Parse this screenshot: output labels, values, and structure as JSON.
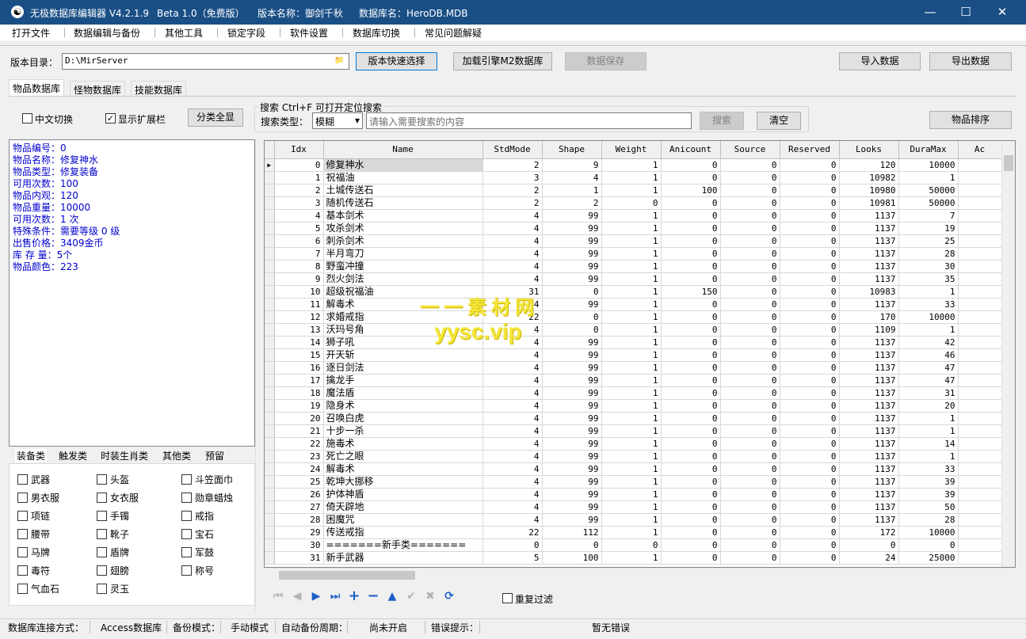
{
  "window": {
    "icon": "☯",
    "app_title": "无极数据库编辑器 V4.2.1.9",
    "edition": "Beta 1.0（免费版）",
    "version_name": "版本名称：御剑千秋",
    "db_name": "数据库名：HeroDB.MDB",
    "minimize_icon": "—",
    "maximize_icon": "☐",
    "close_icon": "✕"
  },
  "menu": [
    "打开文件",
    "数据编辑与备份",
    "其他工具",
    "锁定字段",
    "软件设置",
    "数据库切换",
    "常见问题解疑"
  ],
  "toolbar": {
    "dir_label": "版本目录：",
    "dir_value": "D:\\MirServer",
    "folder_icon": "📁",
    "quick_select": "版本快速选择",
    "load_engine": "加载引擎M2数据库",
    "save_data": "数据保存",
    "import": "导入数据",
    "export": "导出数据"
  },
  "tabs": [
    "物品数据库",
    "怪物数据库",
    "技能数据库"
  ],
  "options": {
    "chinese_switch": "中文切换",
    "show_extend": "显示扩展栏",
    "show_extend_checked": true,
    "chinese_checked": false,
    "show_all": "分类全显",
    "checkmark": "✓"
  },
  "search": {
    "group_title": "搜索   Ctrl+F 可打开定位搜索",
    "type_label": "搜索类型：",
    "type_value": "模糊",
    "placeholder": "请输入需要搜索的内容",
    "search_btn": "搜索",
    "clear_btn": "清空",
    "sort_btn": "物品排序",
    "dropdown_icon": "▾"
  },
  "info": [
    "物品编号：0",
    "物品名称：修复神水",
    "物品类型：修复装备",
    "可用次数：100",
    "物品内观：120",
    "物品重量：10000",
    "可用次数：1 次",
    "特殊条件：需要等级 0 级",
    "出售价格：3409金币",
    "库 存 量：5个",
    "物品颜色：223"
  ],
  "category_tabs": [
    "装备类",
    "触发类",
    "时装生肖类",
    "其他类",
    "预留"
  ],
  "categories": [
    [
      "武器",
      "头盔",
      "斗笠面巾"
    ],
    [
      "男衣服",
      "女衣服",
      "勋章蜡烛"
    ],
    [
      "项链",
      "手镯",
      "戒指"
    ],
    [
      "腰带",
      "靴子",
      "宝石"
    ],
    [
      "马牌",
      "盾牌",
      "军鼓"
    ],
    [
      "毒符",
      "翅膀",
      "称号"
    ],
    [
      "气血石",
      "灵玉",
      ""
    ]
  ],
  "grid": {
    "columns": [
      "Idx",
      "Name",
      "StdMode",
      "Shape",
      "Weight",
      "Anicount",
      "Source",
      "Reserved",
      "Looks",
      "DuraMax",
      "Ac"
    ],
    "row_indicator": "▶",
    "rows": [
      [
        "0",
        "修复神水",
        "2",
        "9",
        "1",
        "0",
        "0",
        "0",
        "120",
        "10000"
      ],
      [
        "1",
        "祝福油",
        "3",
        "4",
        "1",
        "0",
        "0",
        "0",
        "10982",
        "1"
      ],
      [
        "2",
        "土城传送石",
        "2",
        "1",
        "1",
        "100",
        "0",
        "0",
        "10980",
        "50000"
      ],
      [
        "3",
        "随机传送石",
        "2",
        "2",
        "0",
        "0",
        "0",
        "0",
        "10981",
        "50000"
      ],
      [
        "4",
        "基本剑术",
        "4",
        "99",
        "1",
        "0",
        "0",
        "0",
        "1137",
        "7"
      ],
      [
        "5",
        "攻杀剑术",
        "4",
        "99",
        "1",
        "0",
        "0",
        "0",
        "1137",
        "19"
      ],
      [
        "6",
        "刺杀剑术",
        "4",
        "99",
        "1",
        "0",
        "0",
        "0",
        "1137",
        "25"
      ],
      [
        "7",
        "半月弯刀",
        "4",
        "99",
        "1",
        "0",
        "0",
        "0",
        "1137",
        "28"
      ],
      [
        "8",
        "野蛮冲撞",
        "4",
        "99",
        "1",
        "0",
        "0",
        "0",
        "1137",
        "30"
      ],
      [
        "9",
        "烈火剑法",
        "4",
        "99",
        "1",
        "0",
        "0",
        "0",
        "1137",
        "35"
      ],
      [
        "10",
        "超级祝福油",
        "31",
        "0",
        "1",
        "150",
        "0",
        "0",
        "10983",
        "1"
      ],
      [
        "11",
        "解毒术",
        "4",
        "99",
        "1",
        "0",
        "0",
        "0",
        "1137",
        "33"
      ],
      [
        "12",
        "求婚戒指",
        "22",
        "0",
        "1",
        "0",
        "0",
        "0",
        "170",
        "10000"
      ],
      [
        "13",
        "沃玛号角",
        "4",
        "0",
        "1",
        "0",
        "0",
        "0",
        "1109",
        "1"
      ],
      [
        "14",
        "狮子吼",
        "4",
        "99",
        "1",
        "0",
        "0",
        "0",
        "1137",
        "42"
      ],
      [
        "15",
        "开天斩",
        "4",
        "99",
        "1",
        "0",
        "0",
        "0",
        "1137",
        "46"
      ],
      [
        "16",
        "逐日剑法",
        "4",
        "99",
        "1",
        "0",
        "0",
        "0",
        "1137",
        "47"
      ],
      [
        "17",
        "擒龙手",
        "4",
        "99",
        "1",
        "0",
        "0",
        "0",
        "1137",
        "47"
      ],
      [
        "18",
        "魔法盾",
        "4",
        "99",
        "1",
        "0",
        "0",
        "0",
        "1137",
        "31"
      ],
      [
        "19",
        "隐身术",
        "4",
        "99",
        "1",
        "0",
        "0",
        "0",
        "1137",
        "20"
      ],
      [
        "20",
        "召唤白虎",
        "4",
        "99",
        "1",
        "0",
        "0",
        "0",
        "1137",
        "1"
      ],
      [
        "21",
        "十步一杀",
        "4",
        "99",
        "1",
        "0",
        "0",
        "0",
        "1137",
        "1"
      ],
      [
        "22",
        "施毒术",
        "4",
        "99",
        "1",
        "0",
        "0",
        "0",
        "1137",
        "14"
      ],
      [
        "23",
        "死亡之眼",
        "4",
        "99",
        "1",
        "0",
        "0",
        "0",
        "1137",
        "1"
      ],
      [
        "24",
        "解毒术",
        "4",
        "99",
        "1",
        "0",
        "0",
        "0",
        "1137",
        "33"
      ],
      [
        "25",
        "乾坤大挪移",
        "4",
        "99",
        "1",
        "0",
        "0",
        "0",
        "1137",
        "39"
      ],
      [
        "26",
        "护体神盾",
        "4",
        "99",
        "1",
        "0",
        "0",
        "0",
        "1137",
        "39"
      ],
      [
        "27",
        "倚天辟地",
        "4",
        "99",
        "1",
        "0",
        "0",
        "0",
        "1137",
        "50"
      ],
      [
        "28",
        "困魔咒",
        "4",
        "99",
        "1",
        "0",
        "0",
        "0",
        "1137",
        "28"
      ],
      [
        "29",
        "传送戒指",
        "22",
        "112",
        "1",
        "0",
        "0",
        "0",
        "172",
        "10000"
      ],
      [
        "30",
        "=======新手类=======",
        "0",
        "0",
        "0",
        "0",
        "0",
        "0",
        "0",
        "0"
      ],
      [
        "31",
        "新手武器",
        "5",
        "100",
        "1",
        "0",
        "0",
        "0",
        "24",
        "25000"
      ]
    ]
  },
  "nav": {
    "first": "⏮",
    "prev": "◀",
    "next": "▶",
    "last": "⏭",
    "add": "+",
    "delete": "−",
    "up": "▲",
    "confirm": "✔",
    "cancel": "✖",
    "refresh": "⟳",
    "dup_filter": "重复过滤"
  },
  "status": {
    "conn_label": "数据库连接方式：",
    "conn_value": "Access数据库",
    "backup_label": "备份模式：",
    "backup_value": "手动模式",
    "auto_label": "自动备份周期：",
    "auto_value": "尚未开启",
    "err_label": "错误提示：",
    "err_value": "暂无错误"
  },
  "watermark": {
    "line1": "一一素材网",
    "line2": "yysc.vip"
  }
}
